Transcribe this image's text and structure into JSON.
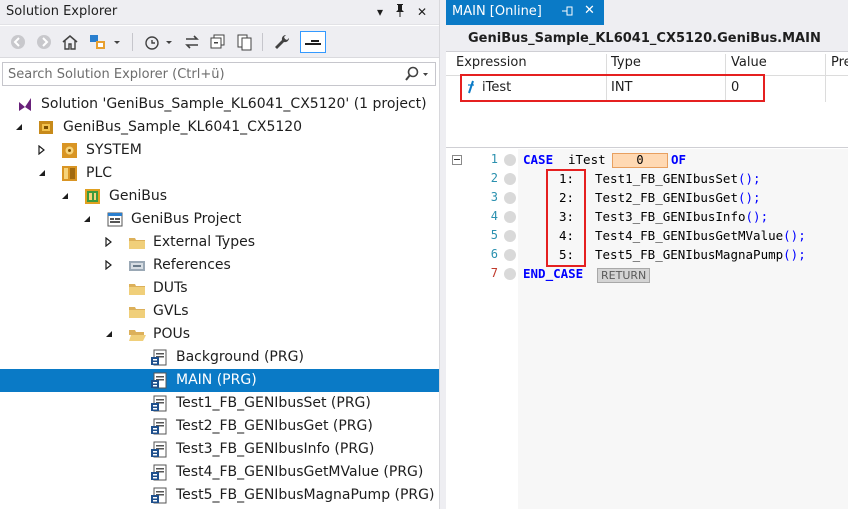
{
  "solution_explorer": {
    "title": "Solution Explorer",
    "search_placeholder": "Search Solution Explorer (Ctrl+ü)",
    "tree": [
      {
        "label": "Solution 'GeniBus_Sample_KL6041_CX5120' (1 project)",
        "icon": "visual-studio-solution-icon",
        "expander": "none",
        "depth": 0
      },
      {
        "label": "GeniBus_Sample_KL6041_CX5120",
        "icon": "twincat-project-icon",
        "expander": "expanded",
        "depth": 0
      },
      {
        "label": "SYSTEM",
        "icon": "system-icon",
        "expander": "collapsed",
        "depth": 1
      },
      {
        "label": "PLC",
        "icon": "plc-icon",
        "expander": "expanded",
        "depth": 1
      },
      {
        "label": "GeniBus",
        "icon": "plc-project-icon",
        "expander": "expanded",
        "depth": 2
      },
      {
        "label": "GeniBus Project",
        "icon": "project-file-icon",
        "expander": "expanded",
        "depth": 3
      },
      {
        "label": "External Types",
        "icon": "folder-icon",
        "expander": "collapsed",
        "depth": 4
      },
      {
        "label": "References",
        "icon": "references-icon",
        "expander": "collapsed",
        "depth": 4
      },
      {
        "label": "DUTs",
        "icon": "folder-icon",
        "expander": "none",
        "depth": 4
      },
      {
        "label": "GVLs",
        "icon": "folder-icon",
        "expander": "none",
        "depth": 4
      },
      {
        "label": "POUs",
        "icon": "folder-open-icon",
        "expander": "expanded",
        "depth": 4
      },
      {
        "label": "Background (PRG)",
        "icon": "program-icon",
        "expander": "none",
        "depth": 5
      },
      {
        "label": "MAIN (PRG)",
        "icon": "program-icon",
        "expander": "none",
        "depth": 5,
        "selected": true
      },
      {
        "label": "Test1_FB_GENIbusSet (PRG)",
        "icon": "program-icon",
        "expander": "none",
        "depth": 5
      },
      {
        "label": "Test2_FB_GENIbusGet (PRG)",
        "icon": "program-icon",
        "expander": "none",
        "depth": 5
      },
      {
        "label": "Test3_FB_GENIbusInfo (PRG)",
        "icon": "program-icon",
        "expander": "none",
        "depth": 5
      },
      {
        "label": "Test4_FB_GENIbusGetMValue (PRG)",
        "icon": "program-icon",
        "expander": "none",
        "depth": 5
      },
      {
        "label": "Test5_FB_GENIbusMagnaPump (PRG)",
        "icon": "program-icon",
        "expander": "none",
        "depth": 5
      }
    ]
  },
  "editor": {
    "tab_label": "MAIN [Online]",
    "header": "GeniBus_Sample_KL6041_CX5120.GeniBus.MAIN",
    "watch": {
      "columns": [
        "Expression",
        "Type",
        "Value",
        "Pre"
      ],
      "rows": [
        {
          "expression": "iTest",
          "type": "INT",
          "value": "0"
        }
      ]
    },
    "code": {
      "line_numbers": [
        "1",
        "2",
        "3",
        "4",
        "5",
        "6",
        "7"
      ],
      "case_kw": "CASE",
      "case_var": "iTest",
      "live_value": "0",
      "of_kw": "OF",
      "labels": [
        "1:",
        "2:",
        "3:",
        "4:",
        "5:"
      ],
      "calls": [
        "Test1_FB_GENIbusSet",
        "Test2_FB_GENIbusGet",
        "Test3_FB_GENIbusInfo",
        "Test4_FB_GENIbusGetMValue",
        "Test5_FB_GENIbusMagnaPump"
      ],
      "call_suffix": "();",
      "end_kw": "END_CASE",
      "return_badge": "RETURN"
    }
  },
  "colors": {
    "accent": "#0a7ac6",
    "highlight_box": "#e52020",
    "keyword": "#0000ff",
    "live_value_bg": "#ffd9b3"
  }
}
